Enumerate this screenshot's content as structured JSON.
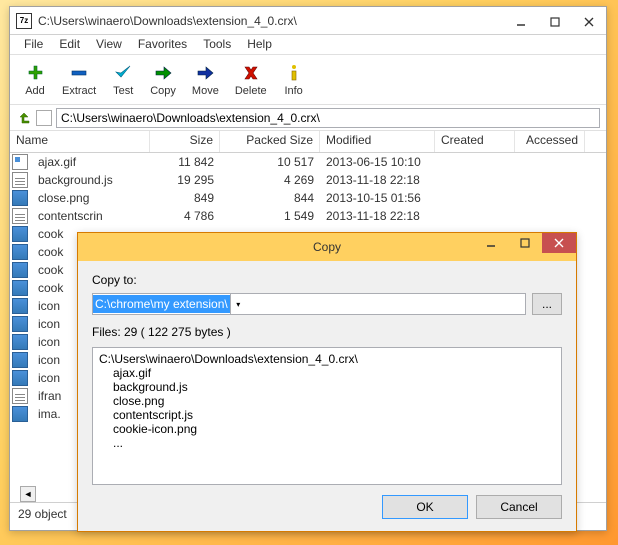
{
  "main": {
    "app_icon_text": "7z",
    "title": "C:\\Users\\winaero\\Downloads\\extension_4_0.crx\\",
    "menu": [
      "File",
      "Edit",
      "View",
      "Favorites",
      "Tools",
      "Help"
    ],
    "toolbar": [
      {
        "name": "add-button",
        "label": "Add",
        "icon": "plus",
        "color": "#2ea000"
      },
      {
        "name": "extract-button",
        "label": "Extract",
        "icon": "minus",
        "color": "#1060c0"
      },
      {
        "name": "test-button",
        "label": "Test",
        "icon": "check",
        "color": "#00b0d0"
      },
      {
        "name": "copy-button",
        "label": "Copy",
        "icon": "arrow",
        "color": "#009000"
      },
      {
        "name": "move-button",
        "label": "Move",
        "icon": "arrow",
        "color": "#1030a0"
      },
      {
        "name": "delete-button",
        "label": "Delete",
        "icon": "x",
        "color": "#d01000"
      },
      {
        "name": "info-button",
        "label": "Info",
        "icon": "i",
        "color": "#e0c000"
      }
    ],
    "path": "C:\\Users\\winaero\\Downloads\\extension_4_0.crx\\",
    "columns": [
      "Name",
      "Size",
      "Packed Size",
      "Modified",
      "Created",
      "Accessed"
    ],
    "files": [
      {
        "icon": "gif",
        "name": "ajax.gif",
        "size": "11 842",
        "packed": "10 517",
        "modified": "2013-06-15 10:10"
      },
      {
        "icon": "js",
        "name": "background.js",
        "size": "19 295",
        "packed": "4 269",
        "modified": "2013-11-18 22:18"
      },
      {
        "icon": "img",
        "name": "close.png",
        "size": "849",
        "packed": "844",
        "modified": "2013-10-15 01:56"
      },
      {
        "icon": "js",
        "name": "contentscrin",
        "size": "4 786",
        "packed": "1 549",
        "modified": "2013-11-18 22:18"
      },
      {
        "icon": "img",
        "name": "cook"
      },
      {
        "icon": "img",
        "name": "cook"
      },
      {
        "icon": "img",
        "name": "cook"
      },
      {
        "icon": "img",
        "name": "cook"
      },
      {
        "icon": "img",
        "name": "icon"
      },
      {
        "icon": "img",
        "name": "icon"
      },
      {
        "icon": "img",
        "name": "icon"
      },
      {
        "icon": "img",
        "name": "icon"
      },
      {
        "icon": "img",
        "name": "icon"
      },
      {
        "icon": "js",
        "name": "ifran"
      },
      {
        "icon": "img",
        "name": "ima."
      }
    ],
    "status": "29 object"
  },
  "dialog": {
    "title": "Copy",
    "copy_to_label": "Copy to:",
    "dest_path": "C:\\chrome\\my extension\\",
    "browse_label": "...",
    "files_info": "Files: 29   ( 122 275 bytes )",
    "source_path": "C:\\Users\\winaero\\Downloads\\extension_4_0.crx\\",
    "preview_files": [
      "ajax.gif",
      "background.js",
      "close.png",
      "contentscript.js",
      "cookie-icon.png",
      "..."
    ],
    "ok_label": "OK",
    "cancel_label": "Cancel"
  }
}
